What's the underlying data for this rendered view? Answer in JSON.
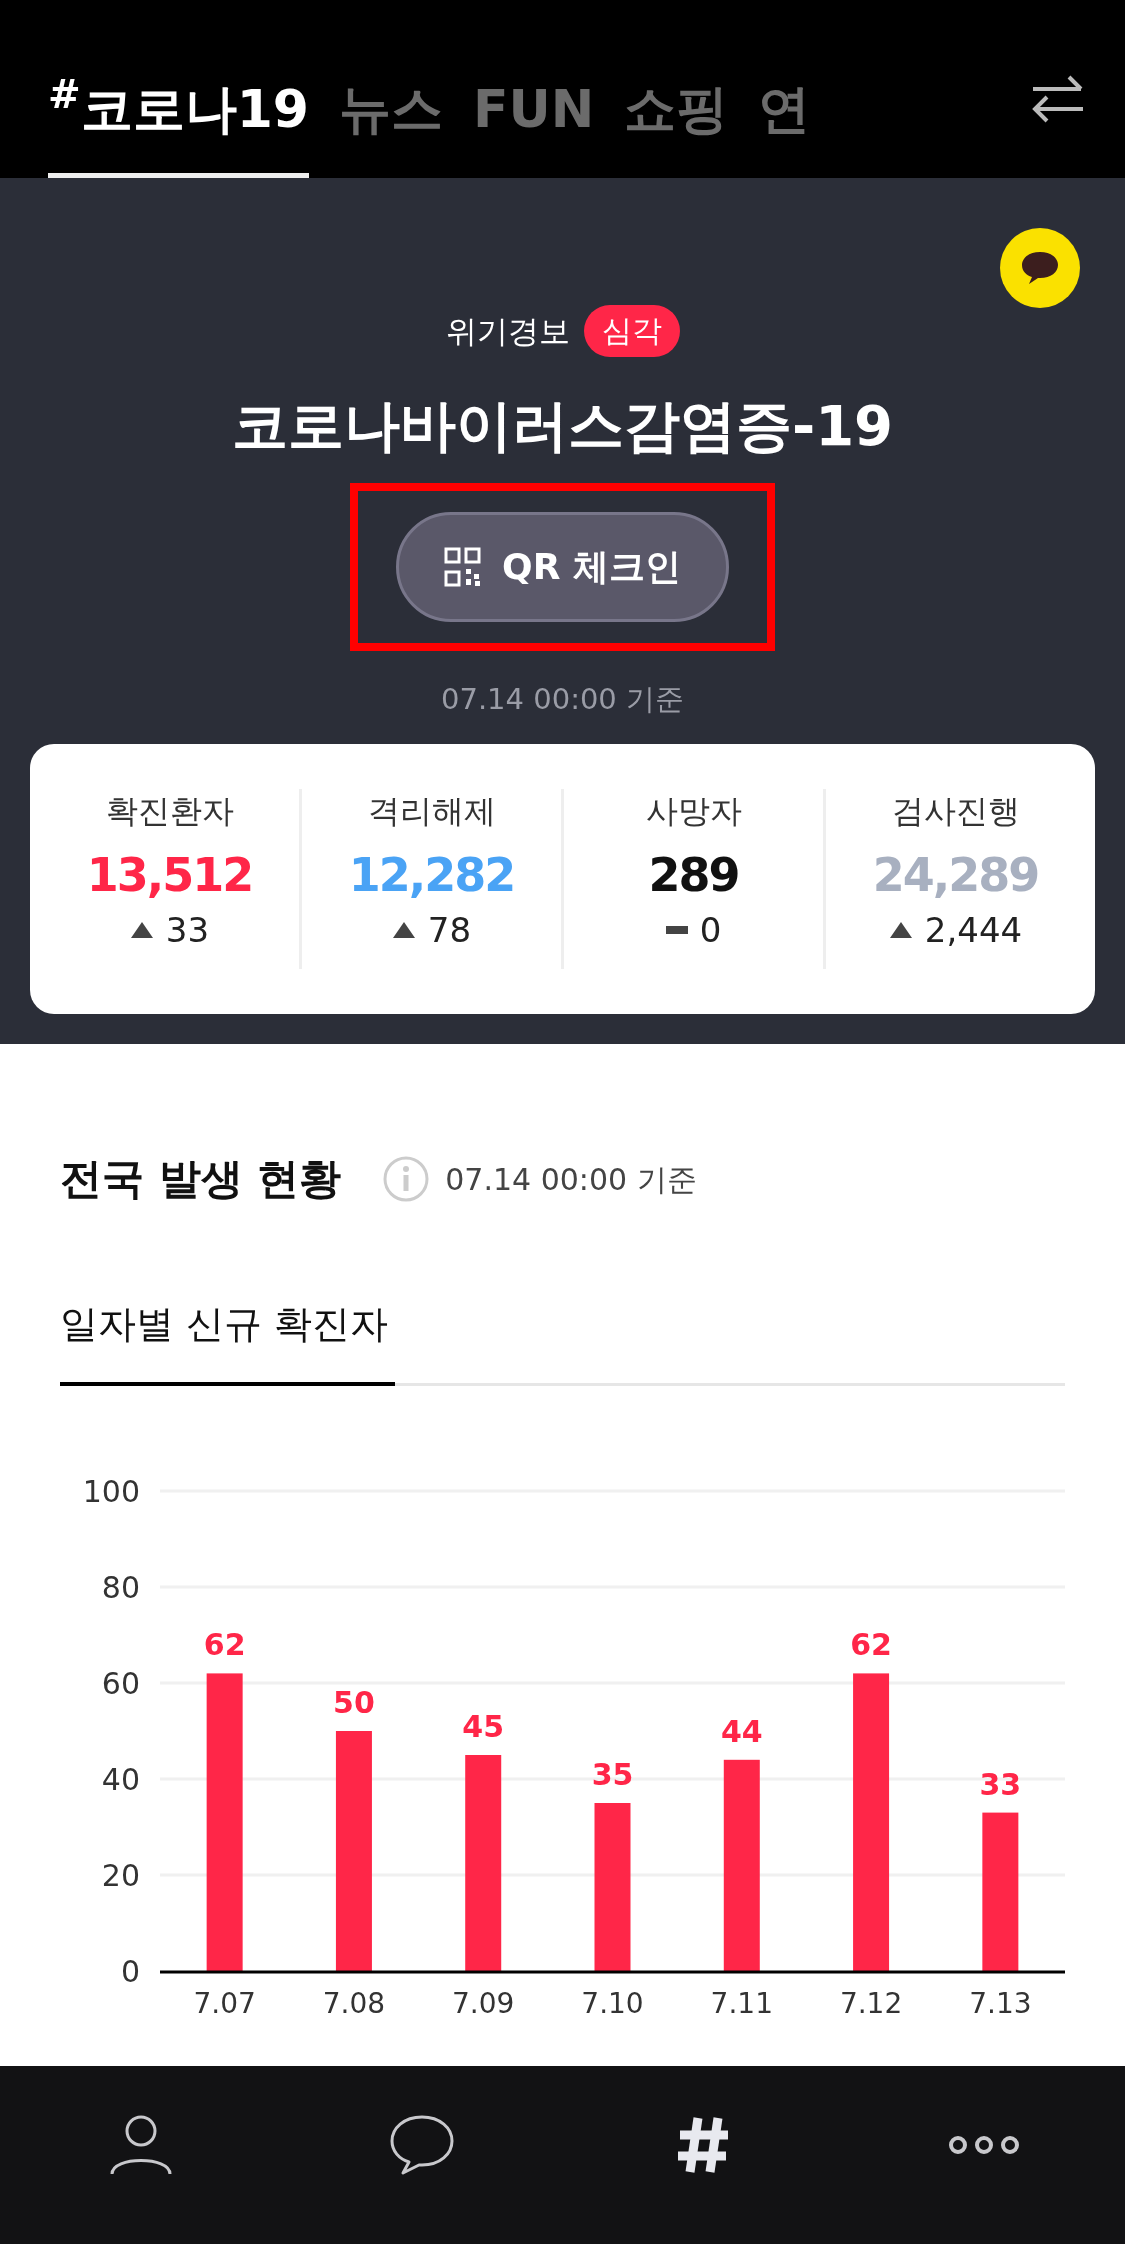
{
  "top_tabs": [
    {
      "label": "$^{#}$코로나19",
      "selected": true
    },
    {
      "label": "뉴스",
      "selected": false
    },
    {
      "label": "FUN",
      "selected": false
    },
    {
      "label": "쇼핑",
      "selected": false
    },
    {
      "label": "연",
      "selected": false
    }
  ],
  "alert": {
    "label": "위기경보",
    "level": "심각"
  },
  "title": "코로나바이러스감염증-19",
  "qr_button": {
    "label": "QR 체크인",
    "highlighted": true
  },
  "updated": "07.14 00:00 기준",
  "stats": [
    {
      "label": "확진환자",
      "value": "13,512",
      "color": "#ff2648",
      "kind": "up",
      "delta": "33"
    },
    {
      "label": "격리해제",
      "value": "12,282",
      "color": "#4aa3f5",
      "kind": "up",
      "delta": "78"
    },
    {
      "label": "사망자",
      "value": "289",
      "color": "#111111",
      "kind": "flat",
      "delta": "0"
    },
    {
      "label": "검사진행",
      "value": "24,289",
      "color": "#a8b0c0",
      "kind": "up",
      "delta": "2,444"
    }
  ],
  "section": {
    "title": "전국 발생 현황",
    "updated": "07.14 00:00 기준"
  },
  "sub_tabs": [
    {
      "label": "일자별 신규 확진자",
      "selected": true
    }
  ],
  "chart_data": {
    "type": "bar",
    "categories": [
      "7.07",
      "7.08",
      "7.09",
      "7.10",
      "7.11",
      "7.12",
      "7.13"
    ],
    "series": [
      {
        "color": "#ff2648",
        "values": [
          62,
          50,
          45,
          35,
          44,
          62,
          33
        ]
      }
    ],
    "ylim": [
      0,
      100
    ],
    "yticks": [
      0,
      20,
      40,
      60,
      80,
      100
    ],
    "grid": true,
    "data_labels": true
  },
  "bottom_nav": [
    {
      "kind": "person",
      "selected": false
    },
    {
      "kind": "chat",
      "selected": false
    },
    {
      "kind": "hash",
      "selected": true
    },
    {
      "kind": "more",
      "selected": false
    }
  ]
}
